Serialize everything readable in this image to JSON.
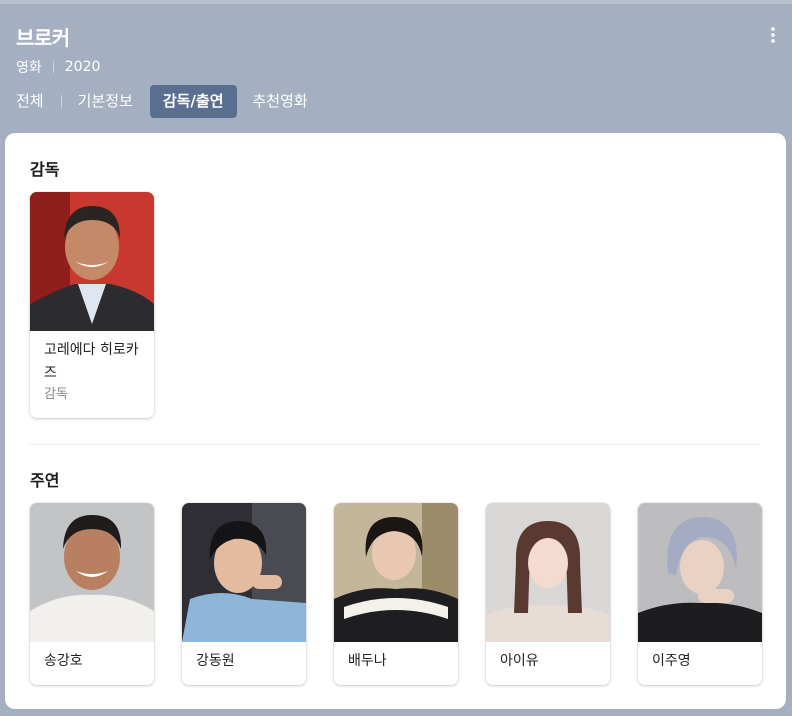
{
  "header": {
    "title": "브로커",
    "meta": [
      "영화",
      "2020"
    ],
    "more_icon": "more-vertical-icon"
  },
  "tabs": [
    {
      "label": "전체",
      "active": false
    },
    {
      "label": "기본정보",
      "active": false
    },
    {
      "label": "감독/출연",
      "active": true
    },
    {
      "label": "추천영화",
      "active": false
    }
  ],
  "directors": {
    "title": "감독",
    "people": [
      {
        "name": "고레에다 히로카즈",
        "role": "감독"
      }
    ]
  },
  "cast": {
    "title": "주연",
    "people": [
      {
        "name": "송강호"
      },
      {
        "name": "강동원"
      },
      {
        "name": "배두나"
      },
      {
        "name": "아이유"
      },
      {
        "name": "이주영"
      }
    ]
  },
  "colors": {
    "header_bg": "#a4afc2",
    "active_tab_bg": "#5a6f8f",
    "card_bg": "#ffffff"
  }
}
